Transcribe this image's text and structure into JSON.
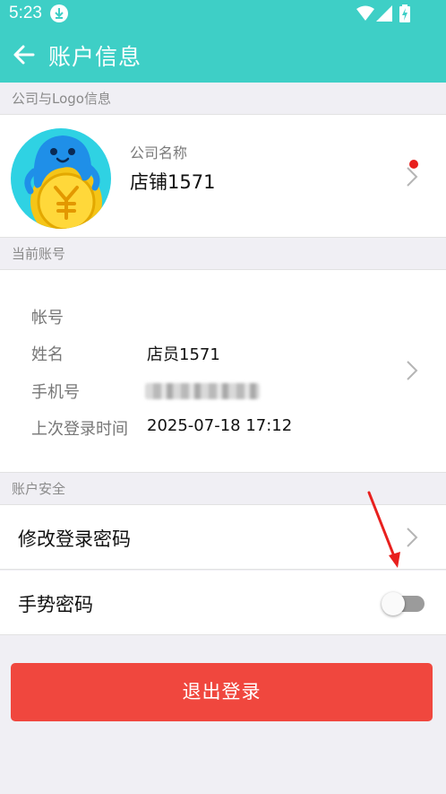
{
  "status_bar": {
    "time": "5:23",
    "icons": [
      "download-icon",
      "wifi-icon",
      "signal-icon",
      "battery-charging-icon"
    ],
    "color": "#3ecfc6"
  },
  "app_bar": {
    "title": "账户信息",
    "back_icon": "arrow-left-icon"
  },
  "company_section": {
    "header": "公司与Logo信息",
    "name_label": "公司名称",
    "name_value": "店铺1571",
    "has_notification_dot": true
  },
  "account_section": {
    "header": "当前账号",
    "rows": [
      {
        "key": "帐号",
        "value": ""
      },
      {
        "key": "姓名",
        "value": "店员1571"
      },
      {
        "key": "手机号",
        "value": ""
      },
      {
        "key": "上次登录时间",
        "value": "2025-07-18 17:12"
      }
    ]
  },
  "security_section": {
    "header": "账户安全",
    "change_password_label": "修改登录密码",
    "gesture_password_label": "手势密码",
    "gesture_password_enabled": false
  },
  "logout_button": {
    "label": "退出登录",
    "color": "#f0473e"
  },
  "colors": {
    "accent": "#3ecfc6",
    "background": "#f0eff4",
    "annotation_red": "#e8201e"
  }
}
